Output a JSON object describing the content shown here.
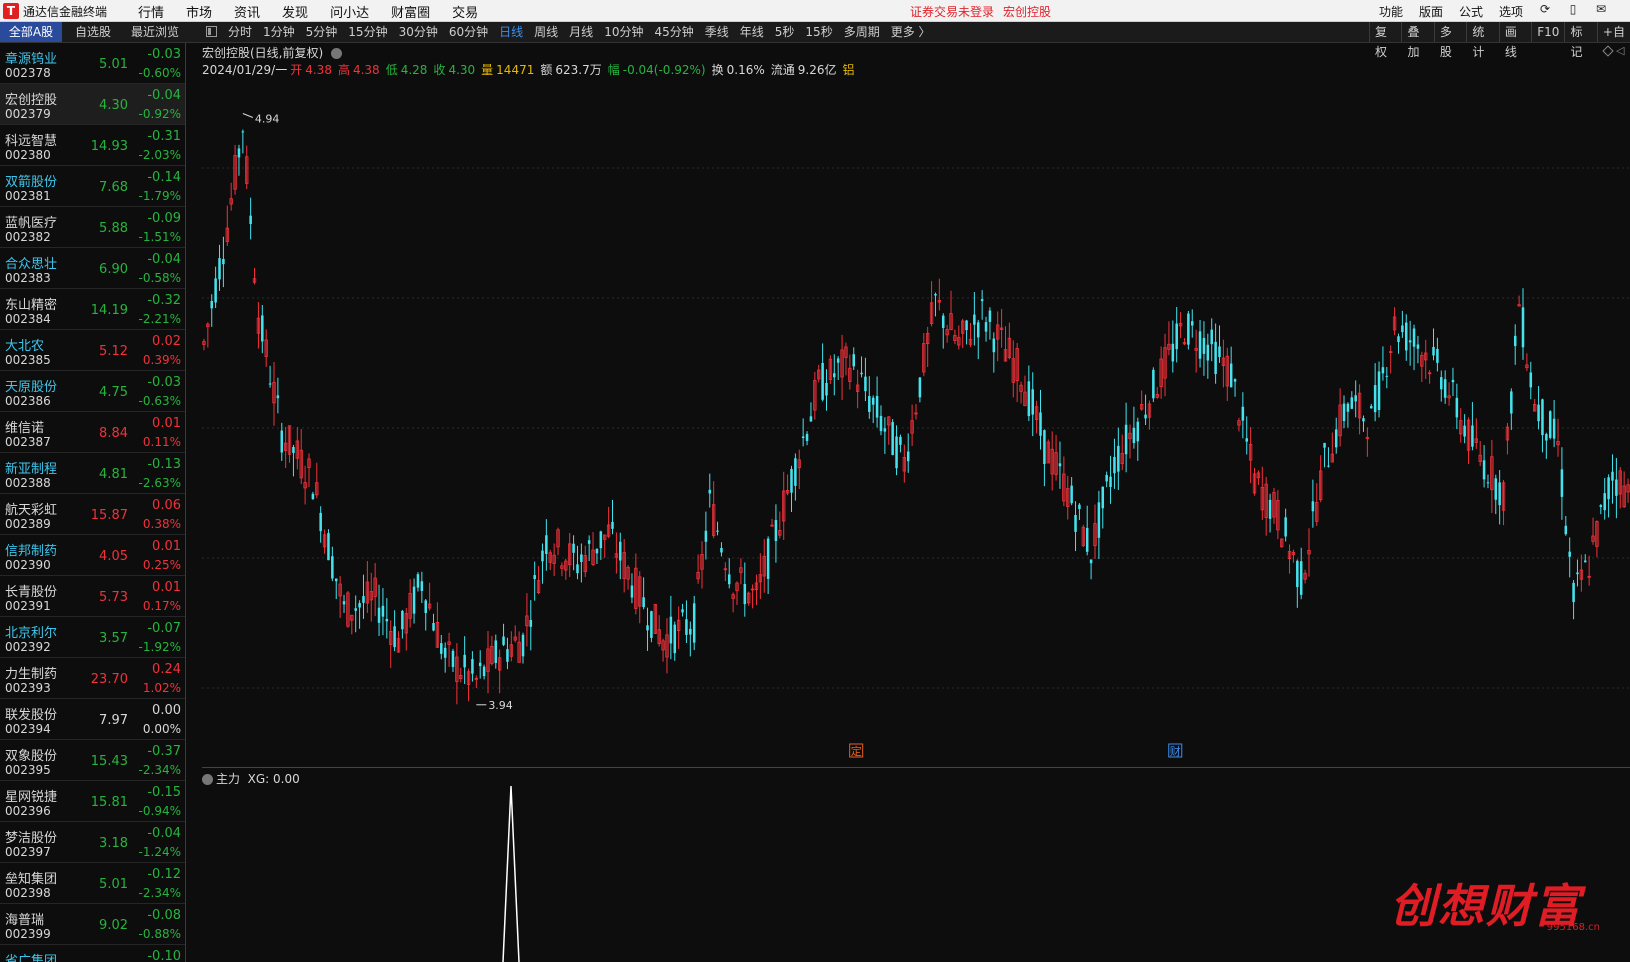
{
  "app": {
    "logo": "T",
    "title": "通达信金融终端"
  },
  "top_menu": [
    "行情",
    "市场",
    "资讯",
    "发现",
    "问小达",
    "财富圈",
    "交易"
  ],
  "login_status": "证券交易未登录",
  "login_stock": "宏创控股",
  "right_menu": [
    "功能",
    "版面",
    "公式",
    "选项"
  ],
  "side_tabs": [
    "全部A股",
    "自选股",
    "最近浏览"
  ],
  "periods": [
    "分时",
    "1分钟",
    "5分钟",
    "15分钟",
    "30分钟",
    "60分钟",
    "日线",
    "周线",
    "月线",
    "10分钟",
    "45分钟",
    "季线",
    "年线",
    "5秒",
    "15秒",
    "多周期",
    "更多 〉"
  ],
  "active_period": "日线",
  "chart_tools": [
    "复权",
    "叠加",
    "多股",
    "统计",
    "画线",
    "F10",
    "标记",
    "+自"
  ],
  "stocks": [
    {
      "name": "章源钨业",
      "code": "002378",
      "price": "5.01",
      "change": "-0.03",
      "pct": "-0.60%",
      "dir": "dn",
      "hl": true
    },
    {
      "name": "宏创控股",
      "code": "002379",
      "price": "4.30",
      "change": "-0.04",
      "pct": "-0.92%",
      "dir": "dn",
      "hl": false
    },
    {
      "name": "科远智慧",
      "code": "002380",
      "price": "14.93",
      "change": "-0.31",
      "pct": "-2.03%",
      "dir": "dn",
      "hl": false
    },
    {
      "name": "双箭股份",
      "code": "002381",
      "price": "7.68",
      "change": "-0.14",
      "pct": "-1.79%",
      "dir": "dn",
      "hl": true
    },
    {
      "name": "蓝帆医疗",
      "code": "002382",
      "price": "5.88",
      "change": "-0.09",
      "pct": "-1.51%",
      "dir": "dn",
      "hl": false
    },
    {
      "name": "合众思壮",
      "code": "002383",
      "price": "6.90",
      "change": "-0.04",
      "pct": "-0.58%",
      "dir": "dn",
      "hl": true
    },
    {
      "name": "东山精密",
      "code": "002384",
      "price": "14.19",
      "change": "-0.32",
      "pct": "-2.21%",
      "dir": "dn",
      "hl": false
    },
    {
      "name": "大北农",
      "code": "002385",
      "price": "5.12",
      "change": "0.02",
      "pct": "0.39%",
      "dir": "up",
      "hl": true
    },
    {
      "name": "天原股份",
      "code": "002386",
      "price": "4.75",
      "change": "-0.03",
      "pct": "-0.63%",
      "dir": "dn",
      "hl": true
    },
    {
      "name": "维信诺",
      "code": "002387",
      "price": "8.84",
      "change": "0.01",
      "pct": "0.11%",
      "dir": "up",
      "hl": false
    },
    {
      "name": "新亚制程",
      "code": "002388",
      "price": "4.81",
      "change": "-0.13",
      "pct": "-2.63%",
      "dir": "dn",
      "hl": true
    },
    {
      "name": "航天彩虹",
      "code": "002389",
      "price": "15.87",
      "change": "0.06",
      "pct": "0.38%",
      "dir": "up",
      "hl": false
    },
    {
      "name": "信邦制药",
      "code": "002390",
      "price": "4.05",
      "change": "0.01",
      "pct": "0.25%",
      "dir": "up",
      "hl": true
    },
    {
      "name": "长青股份",
      "code": "002391",
      "price": "5.73",
      "change": "0.01",
      "pct": "0.17%",
      "dir": "up",
      "hl": false
    },
    {
      "name": "北京利尔",
      "code": "002392",
      "price": "3.57",
      "change": "-0.07",
      "pct": "-1.92%",
      "dir": "dn",
      "hl": true
    },
    {
      "name": "力生制药",
      "code": "002393",
      "price": "23.70",
      "change": "0.24",
      "pct": "1.02%",
      "dir": "up",
      "hl": false
    },
    {
      "name": "联发股份",
      "code": "002394",
      "price": "7.97",
      "change": "0.00",
      "pct": "0.00%",
      "dir": "eq",
      "hl": false
    },
    {
      "name": "双象股份",
      "code": "002395",
      "price": "15.43",
      "change": "-0.37",
      "pct": "-2.34%",
      "dir": "dn",
      "hl": false
    },
    {
      "name": "星网锐捷",
      "code": "002396",
      "price": "15.81",
      "change": "-0.15",
      "pct": "-0.94%",
      "dir": "dn",
      "hl": false
    },
    {
      "name": "梦洁股份",
      "code": "002397",
      "price": "3.18",
      "change": "-0.04",
      "pct": "-1.24%",
      "dir": "dn",
      "hl": false
    },
    {
      "name": "垒知集团",
      "code": "002398",
      "price": "5.01",
      "change": "-0.12",
      "pct": "-2.34%",
      "dir": "dn",
      "hl": false
    },
    {
      "name": "海普瑞",
      "code": "002399",
      "price": "9.02",
      "change": "-0.08",
      "pct": "-0.88%",
      "dir": "dn",
      "hl": false
    },
    {
      "name": "省广集团",
      "code": "",
      "price": "",
      "change": "-0.10",
      "pct": "",
      "dir": "dn",
      "hl": true
    }
  ],
  "chart_header": "宏创控股(日线,前复权)",
  "quote": {
    "date": "2024/01/29/一",
    "open_label": "开",
    "open": "4.38",
    "high_label": "高",
    "high": "4.38",
    "low_label": "低",
    "low": "4.28",
    "close_label": "收",
    "close": "4.30",
    "vol_label": "量",
    "vol": "14471",
    "amount_label": "额",
    "amount": "623.7万",
    "range_label": "幅",
    "range": "-0.04(-0.92%)",
    "turnover_label": "换",
    "turnover": "0.16%",
    "float_label": "流通",
    "float": "9.26亿",
    "sector": "铝"
  },
  "chart_data": {
    "type": "candlestick",
    "price_range": [
      3.85,
      5.0
    ],
    "max_marker": "4.94",
    "min_marker": "3.94",
    "event_markers": [
      "定",
      "财"
    ],
    "candle_colors": {
      "up": "#f2313a",
      "down": "#44e3ee"
    }
  },
  "sub_indicator": {
    "label": "主力",
    "value": "XG: 0.00"
  },
  "watermark": {
    "text": "创想财富",
    "url": "995168.cn"
  }
}
